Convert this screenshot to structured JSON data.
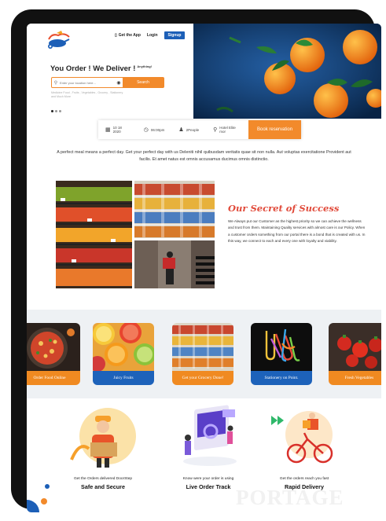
{
  "header": {
    "app_label": "Get the App",
    "login_label": "Login",
    "signup_label": "Signup"
  },
  "hero": {
    "headline": "You Order ! We Deliver !",
    "headline_tag": "Anything!",
    "search_placeholder": "Enter your location here...",
    "search_button": "Search",
    "examples": "Medicine Food , Fruits , Vegetables , Grocery , Stationery and Much More"
  },
  "booking": {
    "date": "10 18 2020",
    "time": "06:00pm",
    "people": "2People",
    "location": "Hotel Elite mor",
    "button": "Book reservation"
  },
  "intro_text": "A perfect meal means a perfect day. Get your perfect day with us Deleniti nihil quibusdam veritatis quae sit non nulla. Aut voluptas exercitatione Provident aut facilis. Et amet natus est omnis accusamus ducimus omnis distinctio.",
  "secret": {
    "title": "Our Secret of Success",
    "text": "We Always put our Customer as the highest priority so we can achieve the wellness and trust from them. Maintaining Quality services with almost care is our Policy. When a customer orders something from our portal there is a bond that is created with us. In this way, we connect to each and every one with loyalty and viability."
  },
  "categories": [
    {
      "label": "Order Food Online",
      "color": "orange"
    },
    {
      "label": "Juicy Fruits",
      "color": "blue"
    },
    {
      "label": "Get your Grocery Done!",
      "color": "orange"
    },
    {
      "label": "Stationery on Point.",
      "color": "blue"
    },
    {
      "label": "Fresh Vegetables",
      "color": "orange"
    }
  ],
  "features": [
    {
      "small": "Get the Orders delivered DoorStep",
      "big": "Safe and Secure"
    },
    {
      "small": "Know were your order is using",
      "big": "Live Order Track"
    },
    {
      "small": "Get the orders reach you fast",
      "big": "Rapid Delivery"
    }
  ],
  "watermark": "PORTAGE",
  "colors": {
    "accent": "#f28a2b",
    "brand": "#1c5fb7",
    "secret_title": "#e14a3a"
  }
}
